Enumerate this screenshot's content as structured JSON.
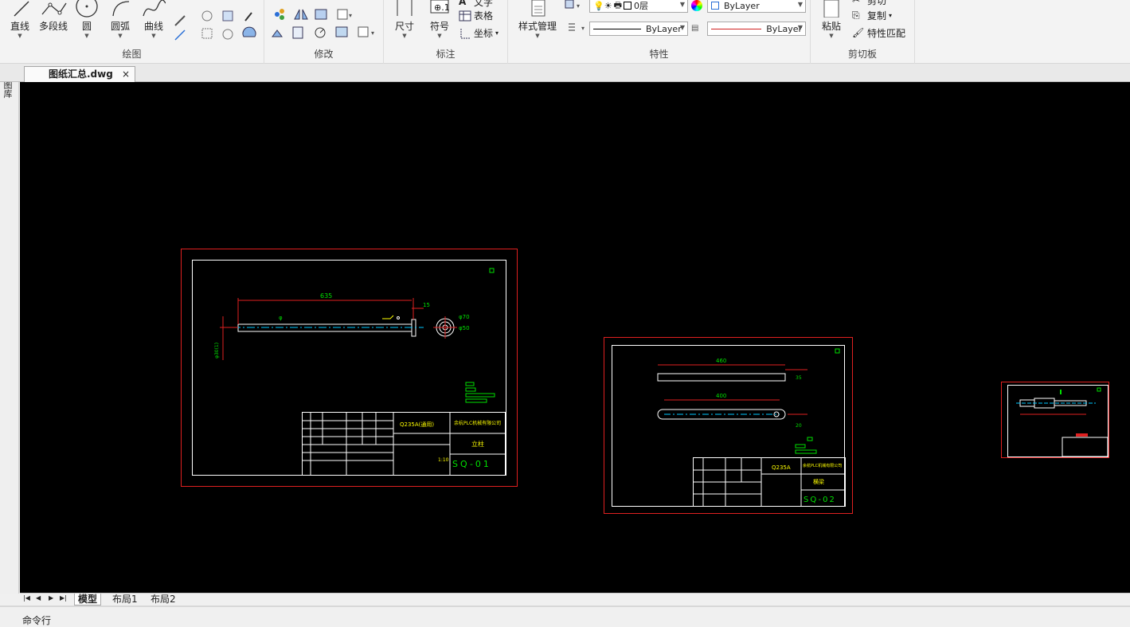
{
  "ribbon": {
    "groups": {
      "draw": {
        "label": "绘图",
        "line": "直线",
        "polyline": "多段线",
        "circle": "圆",
        "arc": "圆弧",
        "curve": "曲线"
      },
      "modify": {
        "label": "修改"
      },
      "annotate": {
        "label": "标注",
        "dimension": "尺寸",
        "symbol": "符号",
        "text": "文字",
        "table": "表格",
        "coord": "坐标"
      },
      "properties": {
        "label": "特性",
        "style_manager": "样式管理",
        "layer_value": "0层",
        "color_value": "ByLayer",
        "linetype_value": "ByLayer",
        "lineweight_value": "ByLayer"
      },
      "clipboard": {
        "label": "剪切板",
        "paste": "粘贴",
        "cut": "剪切",
        "copy": "复制",
        "match": "特性匹配"
      }
    }
  },
  "doc_tab": {
    "title": "图纸汇总.dwg",
    "close": "×"
  },
  "sidebar": {
    "label": "图库"
  },
  "drawings": {
    "sheet1": {
      "dim_length": "635",
      "dim_end": "15",
      "dim_d1": "φ70",
      "dim_d2": "φ50",
      "dim_left": "φ30(1)",
      "material": "Q235A(通用)",
      "company": "余杭PLC机械有限公司",
      "part_name": "立柱",
      "drawing_no": "SQ-01",
      "scale": "1:10"
    },
    "sheet2": {
      "dim_top": "460",
      "dim_bottom": "400",
      "dim_r": "35",
      "dim_h": "20",
      "material": "Q235A",
      "company": "余杭PLC机械有限公司",
      "part_name": "横梁",
      "drawing_no": "SQ-02"
    }
  },
  "layout_tabs": {
    "model": "模型",
    "layout1": "布局1",
    "layout2": "布局2"
  },
  "command_line": {
    "label": "命令行"
  },
  "colors": {
    "canvas": "#000000",
    "border_red": "#e02020",
    "frame_white": "#ffffff",
    "dim_green": "#00e000",
    "text_yellow": "#ffff00",
    "center_cyan": "#00c8ff"
  }
}
